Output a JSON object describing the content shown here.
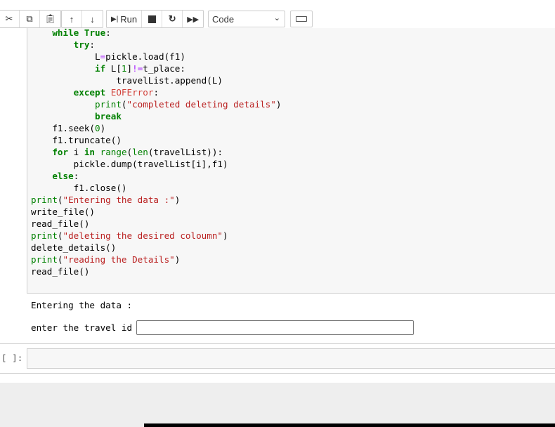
{
  "toolbar": {
    "run_label": "Run",
    "cell_type": "Code"
  },
  "code_lines": [
    [
      [
        "    ",
        ""
      ],
      [
        "while",
        "kw"
      ],
      [
        " ",
        ""
      ],
      [
        "True",
        "kw"
      ],
      [
        ":",
        ""
      ]
    ],
    [
      [
        "        ",
        ""
      ],
      [
        "try",
        "kw"
      ],
      [
        ":",
        ""
      ]
    ],
    [
      [
        "            L",
        ""
      ],
      [
        "=",
        "op"
      ],
      [
        "pickle.load(f1)",
        ""
      ]
    ],
    [
      [
        "            ",
        ""
      ],
      [
        "if",
        "kw"
      ],
      [
        " L[",
        ""
      ],
      [
        "1",
        "num"
      ],
      [
        "]",
        ""
      ],
      [
        "!=",
        "op"
      ],
      [
        "t_place:",
        ""
      ]
    ],
    [
      [
        "                travelList.append(L)",
        ""
      ]
    ],
    [
      [
        "        ",
        ""
      ],
      [
        "except",
        "kw"
      ],
      [
        " ",
        ""
      ],
      [
        "EOFError",
        "ex"
      ],
      [
        ":",
        ""
      ]
    ],
    [
      [
        "            ",
        ""
      ],
      [
        "print",
        "nb"
      ],
      [
        "(",
        ""
      ],
      [
        "\"completed deleting details\"",
        "st"
      ],
      [
        ")",
        ""
      ]
    ],
    [
      [
        "            ",
        ""
      ],
      [
        "break",
        "kw"
      ]
    ],
    [
      [
        "    f1.seek(",
        ""
      ],
      [
        "0",
        "num"
      ],
      [
        ")",
        ""
      ]
    ],
    [
      [
        "    f1.truncate()",
        ""
      ]
    ],
    [
      [
        "    ",
        ""
      ],
      [
        "for",
        "kw"
      ],
      [
        " i ",
        ""
      ],
      [
        "in",
        "kw"
      ],
      [
        " ",
        ""
      ],
      [
        "range",
        "nb"
      ],
      [
        "(",
        ""
      ],
      [
        "len",
        "nb"
      ],
      [
        "(travelList)):",
        ""
      ]
    ],
    [
      [
        "        pickle.dump(travelList[i],f1)",
        ""
      ]
    ],
    [
      [
        "    ",
        ""
      ],
      [
        "else",
        "kw"
      ],
      [
        ":",
        ""
      ]
    ],
    [
      [
        "        f1.close()",
        ""
      ]
    ],
    [
      [
        "print",
        "nb"
      ],
      [
        "(",
        ""
      ],
      [
        "\"Entering the data :\"",
        "st"
      ],
      [
        ")",
        ""
      ]
    ],
    [
      [
        "write_file()",
        ""
      ]
    ],
    [
      [
        "read_file()",
        ""
      ]
    ],
    [
      [
        "print",
        "nb"
      ],
      [
        "(",
        ""
      ],
      [
        "\"deleting the desired coloumn\"",
        "st"
      ],
      [
        ")",
        ""
      ]
    ],
    [
      [
        "delete_details()",
        ""
      ]
    ],
    [
      [
        "print",
        "nb"
      ],
      [
        "(",
        ""
      ],
      [
        "\"reading the Details\"",
        "st"
      ],
      [
        ")",
        ""
      ]
    ],
    [
      [
        "read_file()",
        ""
      ]
    ]
  ],
  "output": {
    "line1": "Entering the data :",
    "prompt_label": "enter the travel id",
    "input_value": ""
  },
  "empty_cell": {
    "prompt": "[ ]:"
  }
}
